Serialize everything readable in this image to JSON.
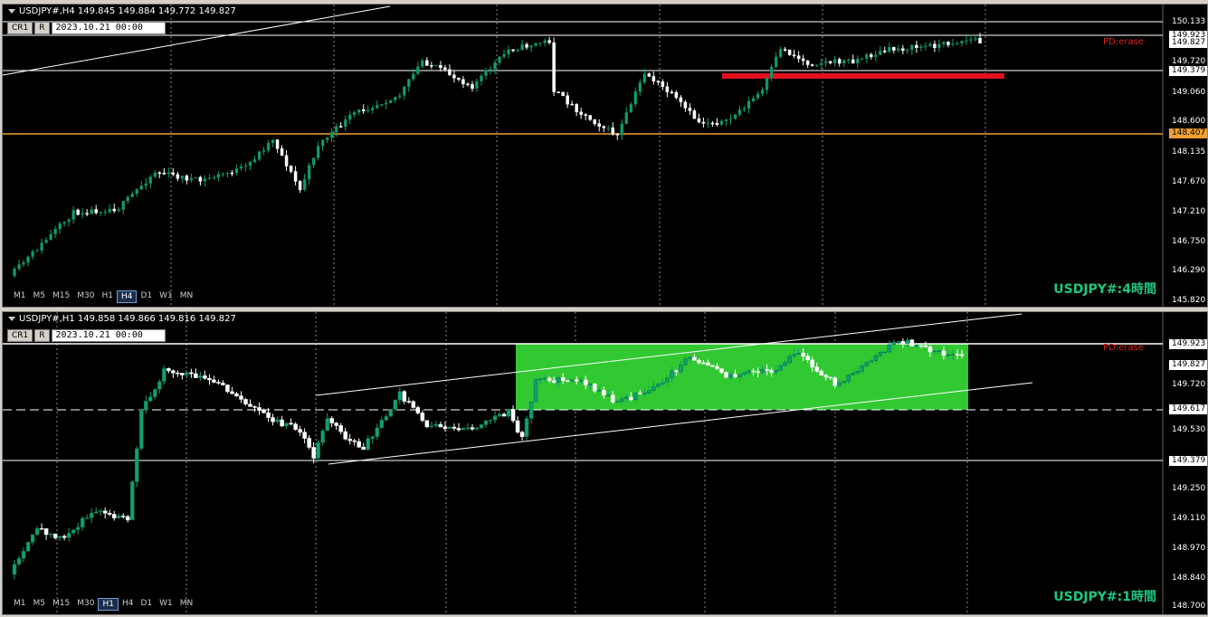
{
  "panes": [
    {
      "id": "h4",
      "header": "USDJPY#,H4  149.845 149.884 149.772 149.827",
      "cr_label": "CR1",
      "r_label": "R",
      "date_value": "2023.10.21  00:00",
      "pd_label": "PD:erase",
      "watermark": "USDJPY#:4時間",
      "timeframes": [
        "M1",
        "M5",
        "M15",
        "M30",
        "H1",
        "H4",
        "D1",
        "W1",
        "MN"
      ],
      "active_tf": "H4",
      "price_labels": [
        {
          "value": "150.133",
          "style": "line"
        },
        {
          "value": "149.923",
          "style": "boxed"
        },
        {
          "value": "149.827",
          "style": "boxed"
        },
        {
          "value": "149.720",
          "style": "plain"
        },
        {
          "value": "149.379",
          "style": "boxed"
        },
        {
          "value": "149.060",
          "style": "plain"
        },
        {
          "value": "148.600",
          "style": "plain"
        },
        {
          "value": "148.407",
          "style": "orange"
        },
        {
          "value": "148.135",
          "style": "plain"
        },
        {
          "value": "147.670",
          "style": "plain"
        },
        {
          "value": "147.210",
          "style": "plain"
        },
        {
          "value": "146.750",
          "style": "plain"
        },
        {
          "value": "146.290",
          "style": "plain"
        },
        {
          "value": "145.820",
          "style": "plain"
        }
      ]
    },
    {
      "id": "h1",
      "header": "USDJPY#,H1  149.858 149.866 149.816 149.827",
      "cr_label": "CR1",
      "r_label": "R",
      "date_value": "2023.10.21  00:00",
      "pd_label": "PD:erase",
      "watermark": "USDJPY#:1時間",
      "timeframes": [
        "M1",
        "M5",
        "M15",
        "M30",
        "H1",
        "H4",
        "D1",
        "W1",
        "MN"
      ],
      "active_tf": "H1",
      "price_labels": [
        {
          "value": "149.923",
          "style": "boxed"
        },
        {
          "value": "149.827",
          "style": "boxed"
        },
        {
          "value": "149.720",
          "style": "plain"
        },
        {
          "value": "149.617",
          "style": "boxed"
        },
        {
          "value": "149.530",
          "style": "plain"
        },
        {
          "value": "149.379",
          "style": "boxed"
        },
        {
          "value": "149.250",
          "style": "plain"
        },
        {
          "value": "149.110",
          "style": "plain"
        },
        {
          "value": "148.970",
          "style": "plain"
        },
        {
          "value": "148.840",
          "style": "plain"
        },
        {
          "value": "148.700",
          "style": "plain"
        }
      ]
    }
  ],
  "colors": {
    "bull": "#10a070",
    "bear": "#ffffff",
    "resistance_zone": "#e0101c",
    "support_line": "#f0a030",
    "range_zone": "#32c832",
    "watermark": "#1ec880"
  }
}
